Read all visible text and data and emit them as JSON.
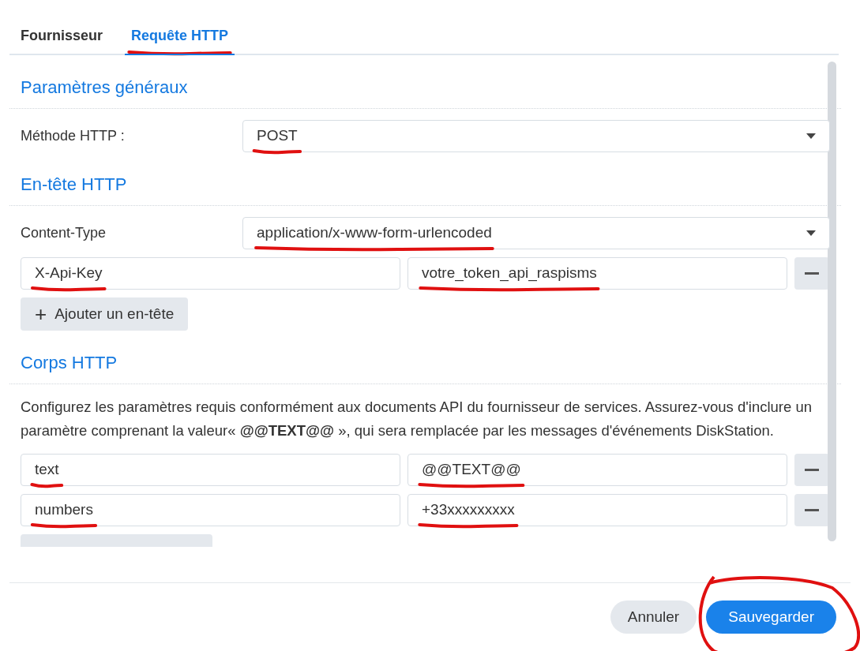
{
  "tabs": [
    {
      "label": "Fournisseur",
      "selected": false,
      "underlined": false
    },
    {
      "label": "Requête HTTP",
      "selected": true,
      "underlined": true
    }
  ],
  "sections": [
    {
      "title": "Paramètres généraux",
      "rows": [
        {
          "kind": "select",
          "label": "Méthode HTTP :",
          "value": "POST",
          "underlined": true
        }
      ]
    },
    {
      "title": "En-tête HTTP",
      "rows": [
        {
          "kind": "select",
          "label": "Content-Type",
          "value": "application/x-www-form-urlencoded",
          "underlined": true
        },
        {
          "kind": "pair",
          "key": "X-Api-Key",
          "value": "votre_token_api_raspisms",
          "key_underlined": true,
          "value_underlined": true
        },
        {
          "kind": "add",
          "label": "Ajouter un en-tête",
          "icon": "+"
        }
      ]
    },
    {
      "title": "Corps HTTP",
      "rows": [
        {
          "kind": "description",
          "text": "Configurez les paramètres requis conformément aux documents API du fournisseur de services. Assurez-vous d'inclure un paramètre comprenant la valeur« **@@TEXT@@** », qui sera remplacée par les messages d'événements DiskStation."
        },
        {
          "kind": "pair",
          "key": "text",
          "value": "@@TEXT@@",
          "key_underlined": true,
          "value_underlined": true
        },
        {
          "kind": "pair",
          "key": "numbers",
          "value": "+33xxxxxxxxx",
          "key_underlined": true,
          "value_underlined": true
        },
        {
          "kind": "partial"
        }
      ]
    }
  ],
  "buttons": [
    {
      "label": "Annuler",
      "kind": "secondary"
    },
    {
      "label": "Sauvegarder",
      "kind": "primary",
      "circled": true
    }
  ]
}
